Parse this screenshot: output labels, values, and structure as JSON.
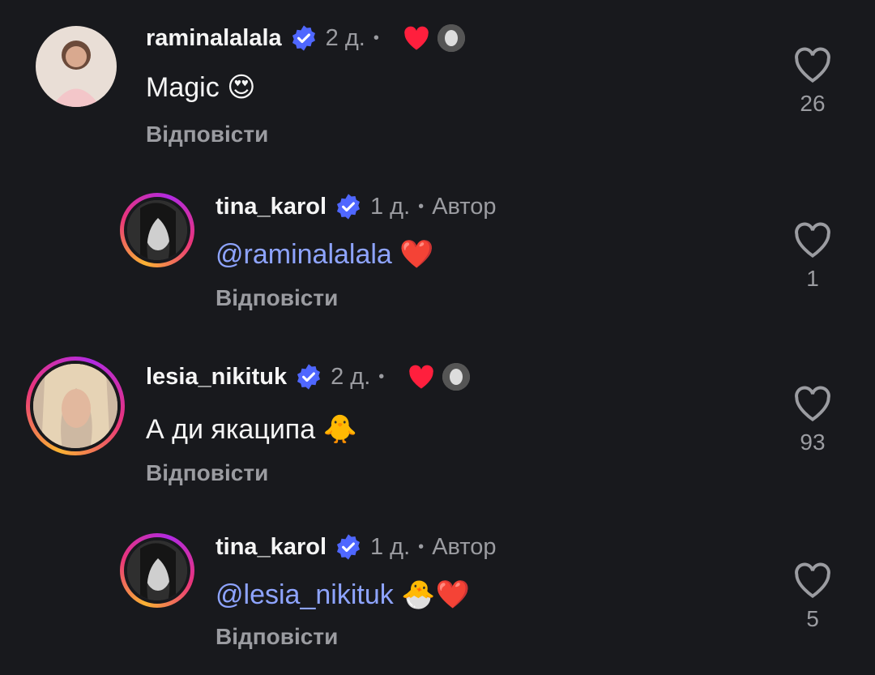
{
  "comments": [
    {
      "username": "raminalalala",
      "time": "2 д.",
      "text": "Magic",
      "emoji": "😍",
      "reply_label": "Відповісти",
      "likes": "26"
    },
    {
      "username": "tina_karol",
      "time": "1 д.",
      "author_label": "Автор",
      "mention": "@raminalalala",
      "emoji": "❤️",
      "reply_label": "Відповісти",
      "likes": "1"
    },
    {
      "username": "lesia_nikituk",
      "time": "2 д.",
      "text": "А ди якаципа",
      "emoji": "🐥",
      "reply_label": "Відповісти",
      "likes": "93"
    },
    {
      "username": "tina_karol",
      "time": "1 д.",
      "author_label": "Автор",
      "mention": "@lesia_nikituk",
      "emoji": "🐣❤️",
      "reply_label": "Відповісти",
      "likes": "5"
    }
  ],
  "colors": {
    "background": "#18191d",
    "verified": "#4f67ff",
    "mention": "#8ea4ff",
    "heart": "#ff1f3d",
    "secondary_text": "#9b9ca1"
  },
  "icons": [
    "verified-badge-icon",
    "author-liked-heart-icon",
    "like-heart-outline-icon",
    "threads-at-icon"
  ]
}
